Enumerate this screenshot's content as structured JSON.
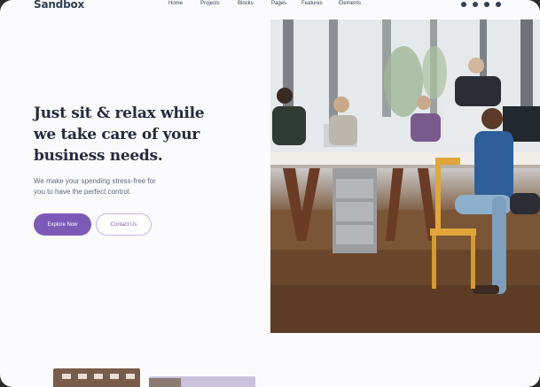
{
  "brand": {
    "name": "Sandbox"
  },
  "nav": {
    "items": [
      {
        "label": "Home"
      },
      {
        "label": "Projects"
      },
      {
        "label": "Blocks"
      },
      {
        "label": "Pages"
      },
      {
        "label": "Features"
      },
      {
        "label": "Elements"
      }
    ]
  },
  "social": {
    "icons": [
      "twitter-icon",
      "facebook-icon",
      "dribbble-icon",
      "instagram-icon"
    ]
  },
  "hero": {
    "headline_line1": "Just sit & relax while",
    "headline_line2": "we take care of your",
    "headline_line3": "business needs.",
    "lead_line1": "We make your spending stress-free for",
    "lead_line2": "you to have the perfect control.",
    "primary_button": "Explore Now",
    "secondary_button": "Contact Us"
  },
  "colors": {
    "accent": "#7d5ab8",
    "heading": "#262b3e",
    "body": "#60697b"
  }
}
